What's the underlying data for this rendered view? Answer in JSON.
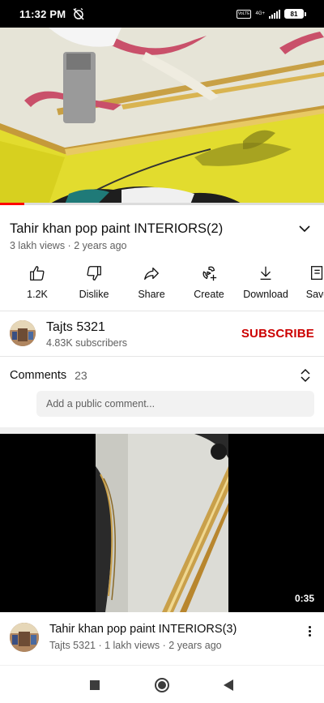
{
  "status_bar": {
    "time": "11:32 PM",
    "volte": "VoLTE",
    "network": "4G+",
    "battery": "81"
  },
  "player": {
    "progress_fraction": 0.075
  },
  "video": {
    "title": "Tahir khan pop paint INTERIORS(2)",
    "meta": "3 lakh views · 2 years ago"
  },
  "actions": [
    {
      "label": "1.2K",
      "icon": "thumbs-up-icon"
    },
    {
      "label": "Dislike",
      "icon": "thumbs-down-icon"
    },
    {
      "label": "Share",
      "icon": "share-icon"
    },
    {
      "label": "Create",
      "icon": "create-icon"
    },
    {
      "label": "Download",
      "icon": "download-icon"
    },
    {
      "label": "Save",
      "icon": "save-icon"
    }
  ],
  "channel": {
    "name": "Tajts 5321",
    "subscribers": "4.83K subscribers",
    "subscribe_label": "SUBSCRIBE"
  },
  "comments": {
    "label": "Comments",
    "count": "23",
    "placeholder": "Add a public comment..."
  },
  "next_video": {
    "duration": "0:35",
    "title": "Tahir khan pop paint INTERIORS(3)",
    "meta": "Tajts 5321 · 1 lakh views · 2 years ago"
  },
  "colors": {
    "accent_red": "#ff0000",
    "subscribe_red": "#cc0000",
    "ceiling_yellow": "#e8e234",
    "ceiling_white": "#e9e7da",
    "trim_gold": "#c59a3a",
    "trim_pink": "#c9506a"
  }
}
